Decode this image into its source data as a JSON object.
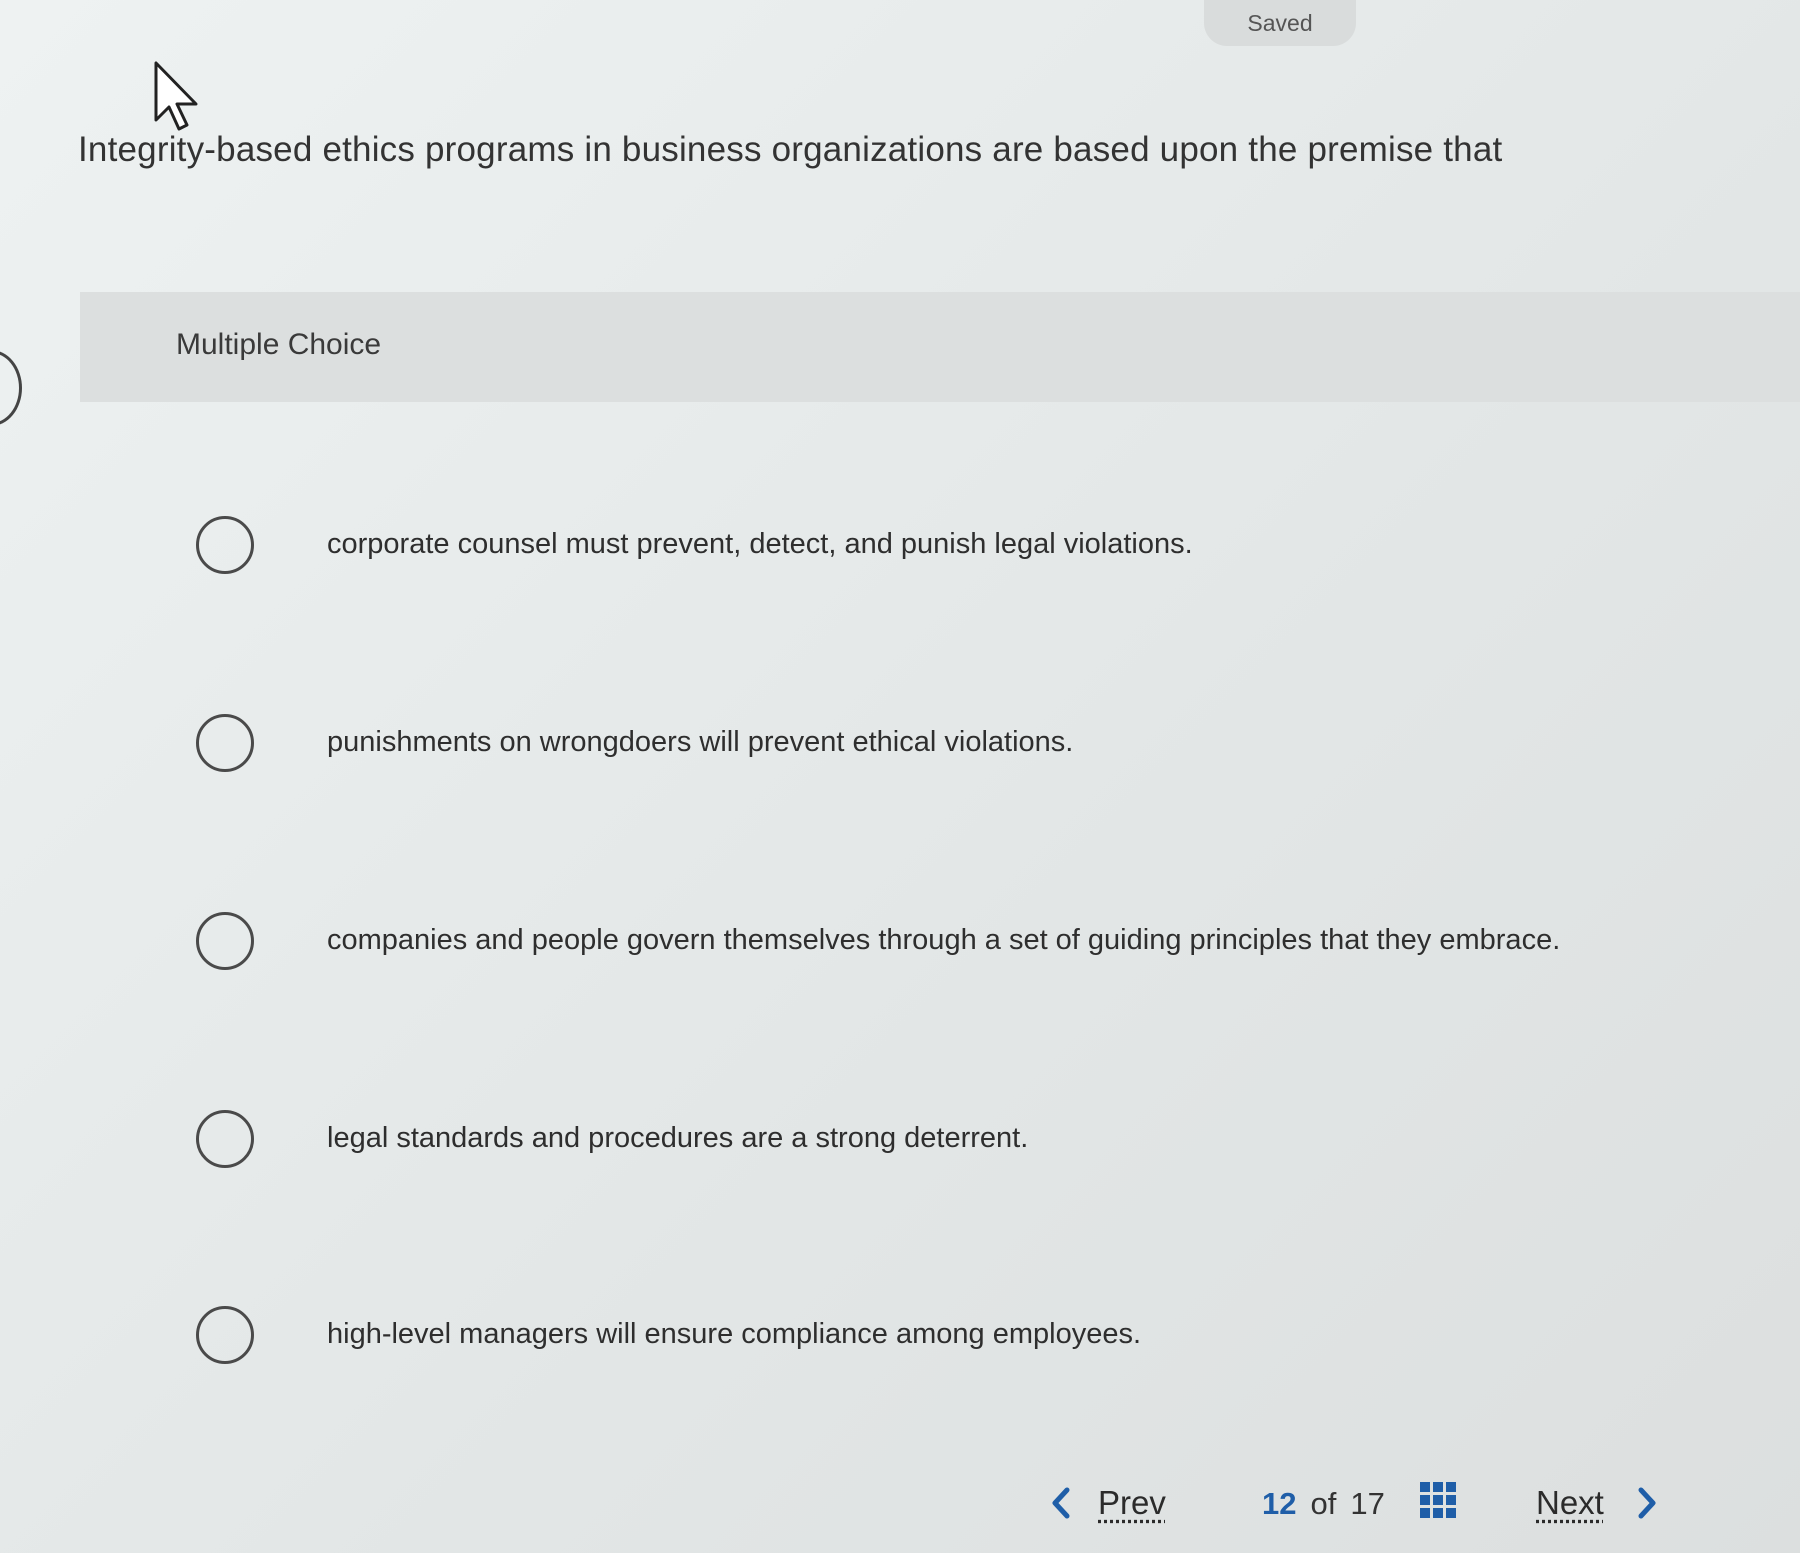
{
  "status": {
    "saved_label": "Saved"
  },
  "question": {
    "text": "Integrity-based ethics programs in business organizations are based upon the premise that"
  },
  "section": {
    "label": "Multiple Choice"
  },
  "choices": [
    {
      "label": "corporate counsel must prevent, detect, and punish legal violations."
    },
    {
      "label": "punishments on wrongdoers will prevent ethical violations."
    },
    {
      "label": "companies and people govern themselves through a set of guiding principles that they embrace."
    },
    {
      "label": "legal standards and procedures are a strong deterrent."
    },
    {
      "label": "high-level managers will ensure compliance among employees."
    }
  ],
  "navigation": {
    "prev_label": "Prev",
    "next_label": "Next",
    "current_page": "12",
    "of_label": "of",
    "total_pages": "17"
  },
  "colors": {
    "accent": "#1f5ea8"
  },
  "icons": {
    "prev": "chevron-left-icon",
    "next": "chevron-right-icon",
    "overview": "grid-icon",
    "pointer": "mouse-cursor-icon"
  }
}
